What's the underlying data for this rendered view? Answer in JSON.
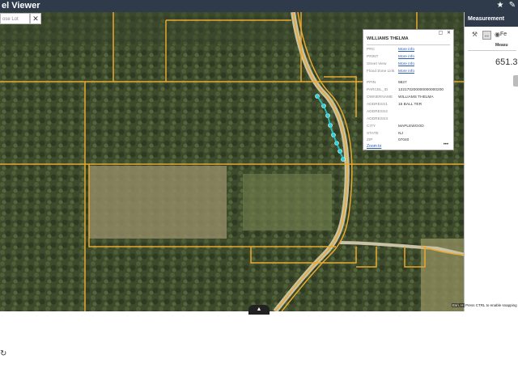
{
  "app": {
    "title": "el Viewer"
  },
  "toolbar": {
    "icons": [
      "help-icon",
      "edit-icon"
    ]
  },
  "search": {
    "placeholder": "ose Lot",
    "button_icon": "close-icon"
  },
  "popup": {
    "title": "WILLIAMS THELMA",
    "rows": [
      {
        "key": "PRC",
        "value": "More info",
        "link": true
      },
      {
        "key": "PRINT",
        "value": "More info",
        "link": true
      },
      {
        "key": "Street View",
        "value": "More info",
        "link": true
      },
      {
        "key": "Flood Zone Link",
        "value": "More info",
        "link": true
      },
      {
        "key": "PPIN",
        "value": "9827",
        "link": false
      },
      {
        "key": "PARCEL_ID",
        "value": "122170200000000000200",
        "link": false
      },
      {
        "key": "OWNERNAME",
        "value": "WILLIAMS THELMA",
        "link": false
      },
      {
        "key": "ADDRESS1",
        "value": "15 BALL TER",
        "link": false
      },
      {
        "key": "ADDRESS2",
        "value": "",
        "link": false
      },
      {
        "key": "ADDRESS3",
        "value": "",
        "link": false
      },
      {
        "key": "CITY",
        "value": "MAPLEWOOD",
        "link": false
      },
      {
        "key": "STATE",
        "value": "NJ",
        "link": false
      },
      {
        "key": "ZIP",
        "value": "07040",
        "link": false
      }
    ],
    "zoom_label": "Zoom to",
    "more_label": "•••"
  },
  "measurement": {
    "title": "Measurement",
    "unit": "Fe",
    "result_label": "Measu",
    "value": "651.3"
  },
  "attribution": "Esri, H",
  "ctrl_hint": "Press CTRL to enable snapping",
  "colors": {
    "parcel_line": "#e8a92e",
    "measure_point": "#27d3e0",
    "header": "#2f3a4a"
  }
}
